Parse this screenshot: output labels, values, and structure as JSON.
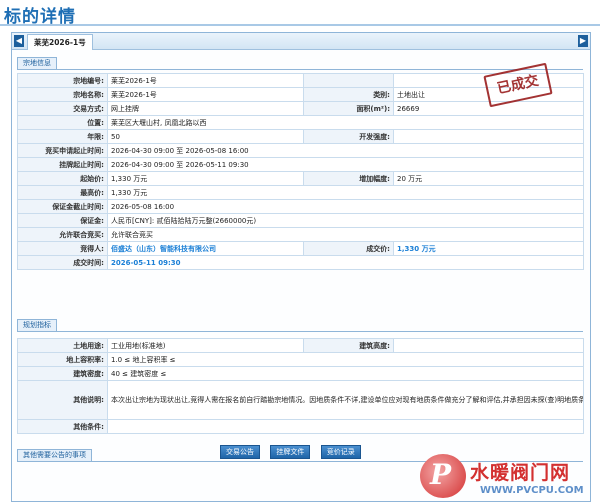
{
  "page": {
    "title": "标的详情"
  },
  "tab": {
    "label": "莱芜2026-1号"
  },
  "sections": {
    "parcel": "宗地信息",
    "planning": "规划指标",
    "other": "其他需要公告的事项"
  },
  "stamp": "已成交",
  "parcel": {
    "code_label": "宗地编号:",
    "code": "莱芜2026-1号",
    "name_label": "宗地名称:",
    "name": "莱芜2026-1号",
    "category_label": "类别:",
    "category": "土地出让",
    "method_label": "交易方式:",
    "method": "网上挂牌",
    "area_label": "面积(m²):",
    "area": "26669",
    "location_label": "位置:",
    "location": "莱芜区大堰山村, 凤凰北路以西",
    "term_label": "年限:",
    "term": "50",
    "dev_label": "开发强度:",
    "dev": "",
    "apply_label": "竞买申请起止时间:",
    "apply": "2026-04-30 09:00 至 2026-05-08 16:00",
    "listing_label": "挂牌起止时间:",
    "listing": "2026-04-30 09:00 至 2026-05-11 09:30",
    "start_label": "起始价:",
    "start": "1,330 万元",
    "increment_label": "增加幅度:",
    "increment": "20 万元",
    "max_label": "最高价:",
    "max": "1,330 万元",
    "deposit_deadline_label": "保证金截止时间:",
    "deposit_deadline": "2026-05-08 16:00",
    "deposit_label": "保证金:",
    "deposit": "人民币[CNY]: 贰佰陆拾陆万元整(2660000元)",
    "joint_label": "允许联合竞买:",
    "joint": "允许联合竞买",
    "winner_label": "竞得人:",
    "winner": "佰盛达（山东）智能科技有限公司",
    "deal_price_label": "成交价:",
    "deal_price": "1,330 万元",
    "deal_time_label": "成交时间:",
    "deal_time": "2026-05-11 09:30"
  },
  "planning": {
    "use_label": "土地用途:",
    "use": "工业用地(标准地)",
    "height_label": "建筑高度:",
    "height": "",
    "far_label": "地上容积率:",
    "far": "1.0 ≤ 地上容积率 ≤",
    "density_label": "建筑密度:",
    "density": "40 ≤ 建筑密度 ≤",
    "notes_label": "其他说明:",
    "notes": "本次出让宗地为现状出让,竞得人需在报名前自行踏勘宗地情况。因地质条件不详,建设单位应对现有地质条件做充分了解和评估,并承担因未探(查)明地质条件、各类地上地下设施等造成的规划指标不能充分利用或影响动工建设的风险。",
    "conditions_label": "其他条件:",
    "conditions": ""
  },
  "buttons": {
    "announcement": "交易公告",
    "listing_doc": "挂牌文件",
    "bid_record": "竞价记录"
  },
  "watermark": {
    "logo_letter": "P",
    "text": "水暖阀门网",
    "url": "WWW.PVCPU.COM"
  },
  "colors": {
    "title": "#1f6fb5",
    "label_bg": "#eef4fa",
    "winner": "#1a7fd6",
    "stamp": "#9a1e1e",
    "button": "#1f65a8"
  }
}
